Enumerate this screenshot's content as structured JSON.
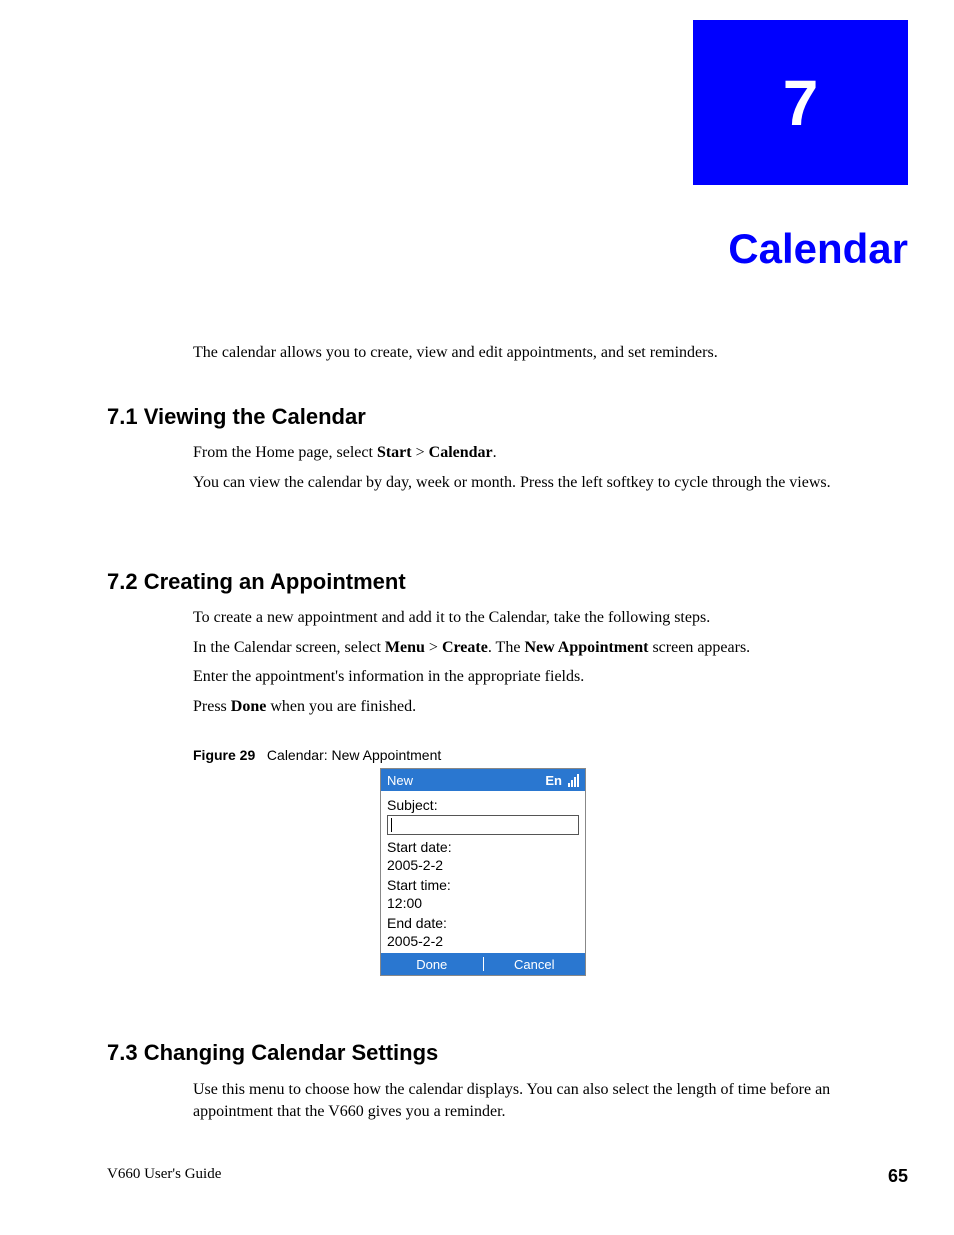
{
  "chapter": {
    "number": "7",
    "title": "Calendar"
  },
  "intro": "The calendar allows you to create, view and edit appointments, and set reminders.",
  "sections": {
    "s1": {
      "heading": "7.1  Viewing the Calendar",
      "p1_prefix": "From the Home page, select ",
      "p1_b1": "Start",
      "p1_mid": " > ",
      "p1_b2": "Calendar",
      "p1_suffix": ".",
      "p2": "You can view the calendar by day, week or month. Press the left softkey to cycle through the views."
    },
    "s2": {
      "heading": "7.2  Creating an Appointment",
      "p1": "To create a new appointment and add it to the Calendar, take the following steps.",
      "p2_prefix": "In the Calendar screen, select ",
      "p2_b1": "Menu",
      "p2_mid1": " > ",
      "p2_b2": "Create",
      "p2_mid2": ". The ",
      "p2_b3": "New Appointment",
      "p2_suffix": " screen appears.",
      "p3": "Enter the appointment's information in the appropriate fields.",
      "p4_prefix": "Press ",
      "p4_b1": "Done",
      "p4_suffix": " when you are finished."
    },
    "s3": {
      "heading": "7.3  Changing Calendar Settings",
      "p1": "Use this menu to choose how the calendar displays. You can also select the length of time before an appointment that the V660 gives you a reminder."
    }
  },
  "figure": {
    "label": "Figure 29",
    "caption": "Calendar: New Appointment"
  },
  "phone": {
    "header_title": "New",
    "header_lang": "En",
    "subject_label": "Subject:",
    "subject_value": "",
    "start_date_label": "Start date:",
    "start_date_value": "2005-2-2",
    "start_time_label": "Start time:",
    "start_time_value": "12:00",
    "end_date_label": "End date:",
    "end_date_value": "2005-2-2",
    "footer_left": "Done",
    "footer_right": "Cancel"
  },
  "footer": {
    "guide": "V660 User's Guide",
    "page": "65"
  }
}
